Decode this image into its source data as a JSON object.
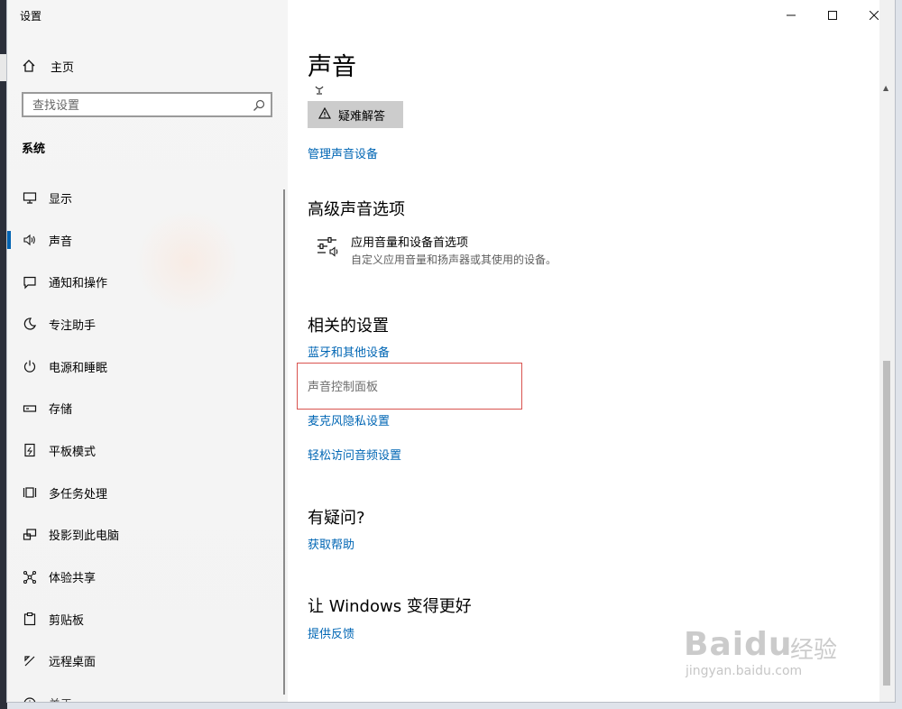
{
  "window": {
    "title": "设置"
  },
  "sidebar": {
    "home_label": "主页",
    "search_placeholder": "查找设置",
    "section_title": "系统",
    "items": [
      {
        "label": "显示"
      },
      {
        "label": "声音"
      },
      {
        "label": "通知和操作"
      },
      {
        "label": "专注助手"
      },
      {
        "label": "电源和睡眠"
      },
      {
        "label": "存储"
      },
      {
        "label": "平板模式"
      },
      {
        "label": "多任务处理"
      },
      {
        "label": "投影到此电脑"
      },
      {
        "label": "体验共享"
      },
      {
        "label": "剪贴板"
      },
      {
        "label": "远程桌面"
      },
      {
        "label": "关于"
      }
    ],
    "active_item": "声音",
    "accent_color": "#0063b1"
  },
  "main": {
    "page_title": "声音",
    "troubleshoot_button": "疑难解答",
    "manage_devices_link": "管理声音设备",
    "advanced": {
      "heading": "高级声音选项",
      "item_title": "应用音量和设备首选项",
      "item_desc": "自定义应用音量和扬声器或其使用的设备。"
    },
    "related": {
      "heading": "相关的设置",
      "links": [
        "蓝牙和其他设备",
        "声音控制面板",
        "麦克风隐私设置",
        "轻松访问音频设置"
      ]
    },
    "question": {
      "heading": "有疑问?",
      "link": "获取帮助"
    },
    "feedback": {
      "heading": "让 Windows 变得更好",
      "link": "提供反馈"
    }
  },
  "watermark": {
    "brand": "Baidu",
    "cn": "经验",
    "url": "jingyan.baidu.com"
  }
}
